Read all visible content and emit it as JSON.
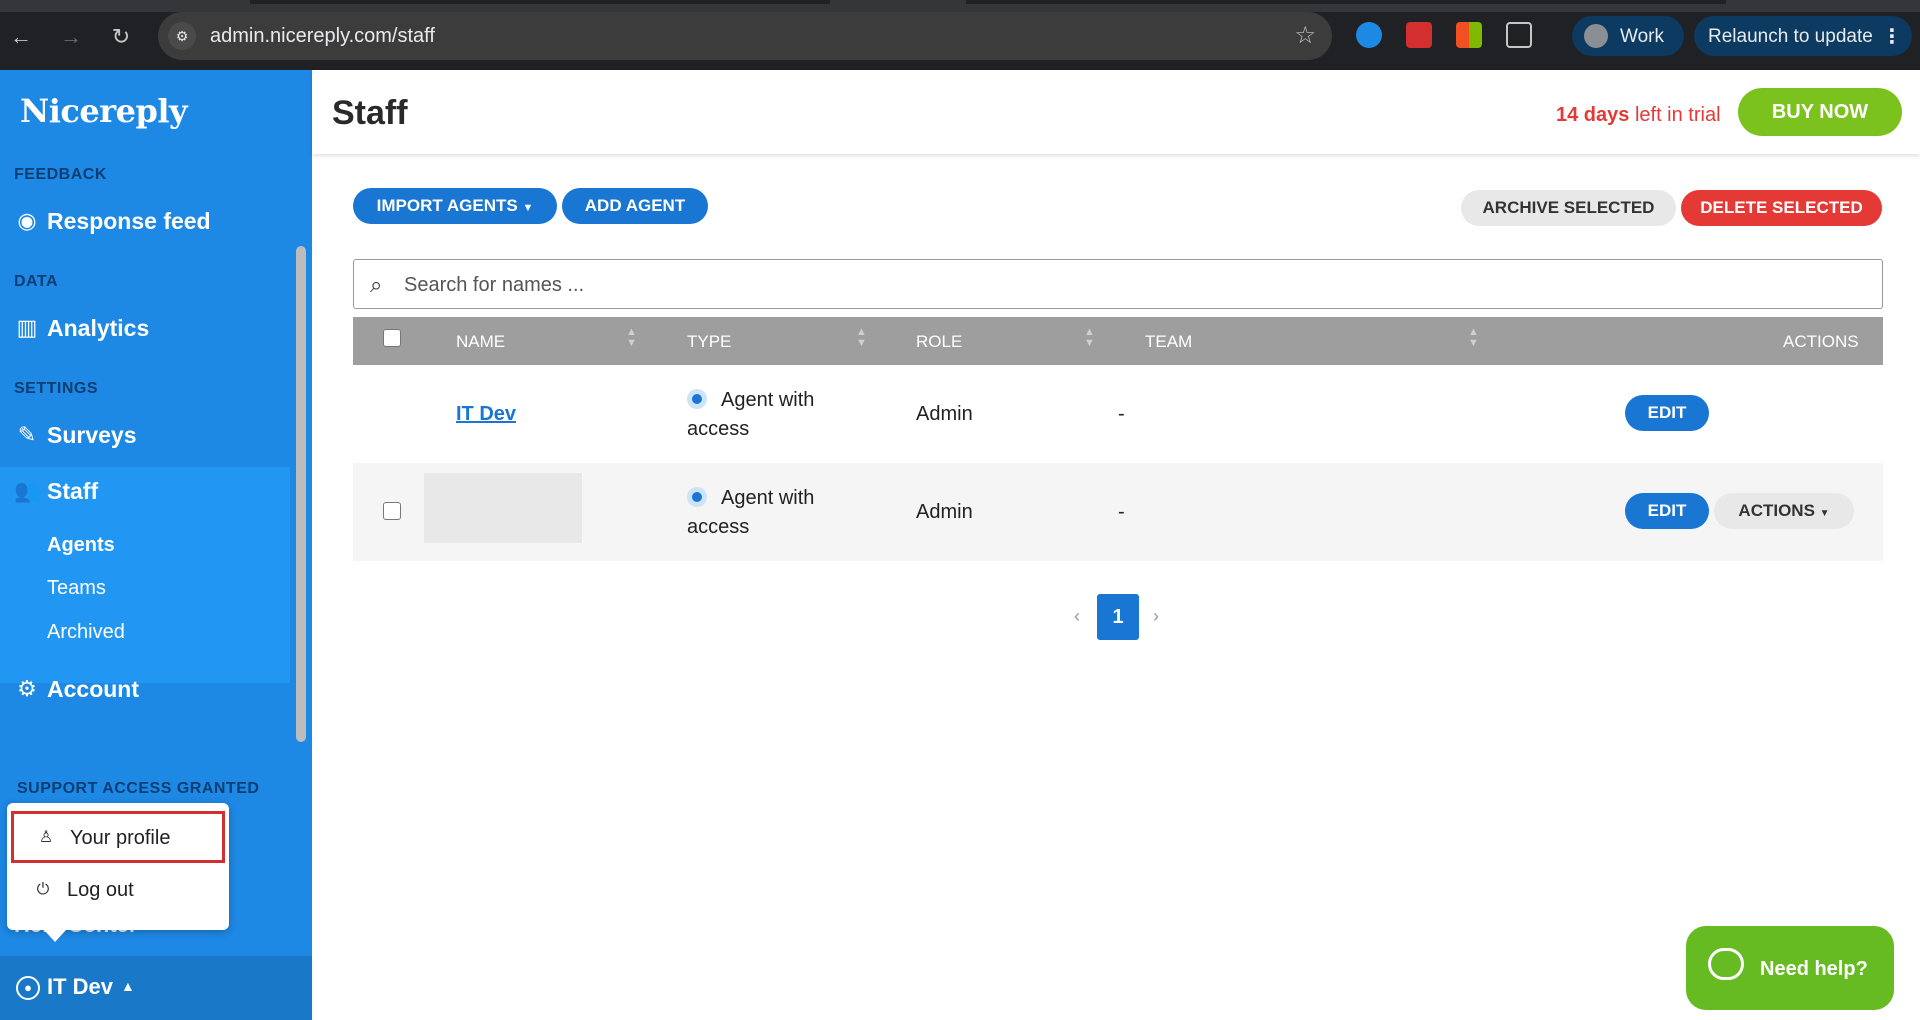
{
  "browser": {
    "url": "admin.nicereply.com/staff",
    "profile_label": "Work",
    "relaunch_label": "Relaunch to update"
  },
  "app": {
    "logo": "Nicereply"
  },
  "sidebar": {
    "sections": {
      "feedback": "FEEDBACK",
      "data": "DATA",
      "settings": "SETTINGS",
      "support": "SUPPORT ACCESS GRANTED"
    },
    "items": {
      "response_feed": "Response feed",
      "analytics": "Analytics",
      "surveys": "Surveys",
      "staff": "Staff",
      "account": "Account",
      "help_center": "Help Center"
    },
    "staff_sub": {
      "agents": "Agents",
      "teams": "Teams",
      "archived": "Archived"
    },
    "user": "IT Dev"
  },
  "user_menu": {
    "profile": "Your profile",
    "logout": "Log out"
  },
  "header": {
    "title": "Staff",
    "trial_days": "14 days",
    "trial_rest": " left in trial",
    "buy": "BUY NOW"
  },
  "toolbar": {
    "import": "IMPORT AGENTS",
    "add": "ADD AGENT",
    "archive": "ARCHIVE SELECTED",
    "delete": "DELETE SELECTED"
  },
  "search": {
    "placeholder": "Search for names ..."
  },
  "table": {
    "columns": {
      "name": "NAME",
      "type": "TYPE",
      "role": "ROLE",
      "team": "TEAM",
      "actions": "ACTIONS"
    },
    "rows": [
      {
        "name": "IT Dev",
        "type_line1": "Agent with",
        "type_line2": "access",
        "role": "Admin",
        "team": "-",
        "edit": "EDIT"
      },
      {
        "name": "",
        "type_line1": "Agent with",
        "type_line2": "access",
        "role": "Admin",
        "team": "-",
        "edit": "EDIT",
        "actions": "ACTIONS"
      }
    ]
  },
  "pagination": {
    "prev": "‹",
    "current": "1",
    "next": "›"
  },
  "help_widget": {
    "label": "Need help?"
  }
}
